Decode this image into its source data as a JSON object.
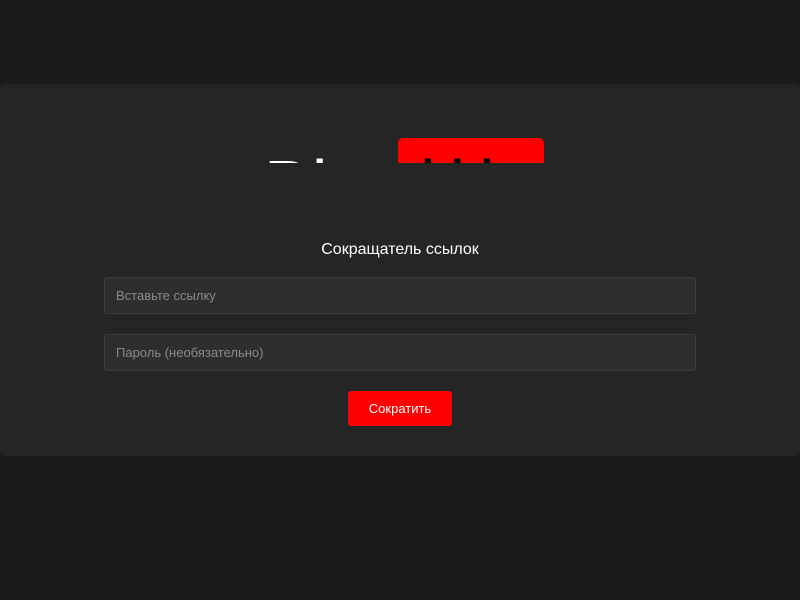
{
  "logo": {
    "text_part": "Bh",
    "block_part": "lil"
  },
  "form": {
    "title": "Сокращатель ссылок",
    "url_placeholder": "Вставьте ссылку",
    "url_value": "",
    "password_placeholder": "Пароль (необязательно)",
    "password_value": "",
    "submit_label": "Сократить"
  },
  "colors": {
    "background": "#1b1b1b",
    "card": "#252525",
    "accent": "#ff0000",
    "input_bg": "#2e2e2e"
  }
}
